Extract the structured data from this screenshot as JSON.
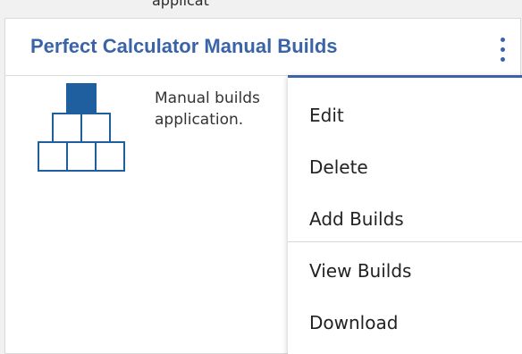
{
  "top_text": "applicat",
  "card": {
    "title": "Perfect Calculator Manual Builds",
    "description": "Manual builds application."
  },
  "menu": {
    "items": [
      {
        "label": "Edit"
      },
      {
        "label": "Delete"
      },
      {
        "label": "Add Builds"
      },
      {
        "label": "View Builds"
      },
      {
        "label": "Download"
      }
    ]
  },
  "colors": {
    "accent": "#3b64a8",
    "pyramid_fill": "#1f5fa0",
    "background": "#f1f1f1"
  }
}
